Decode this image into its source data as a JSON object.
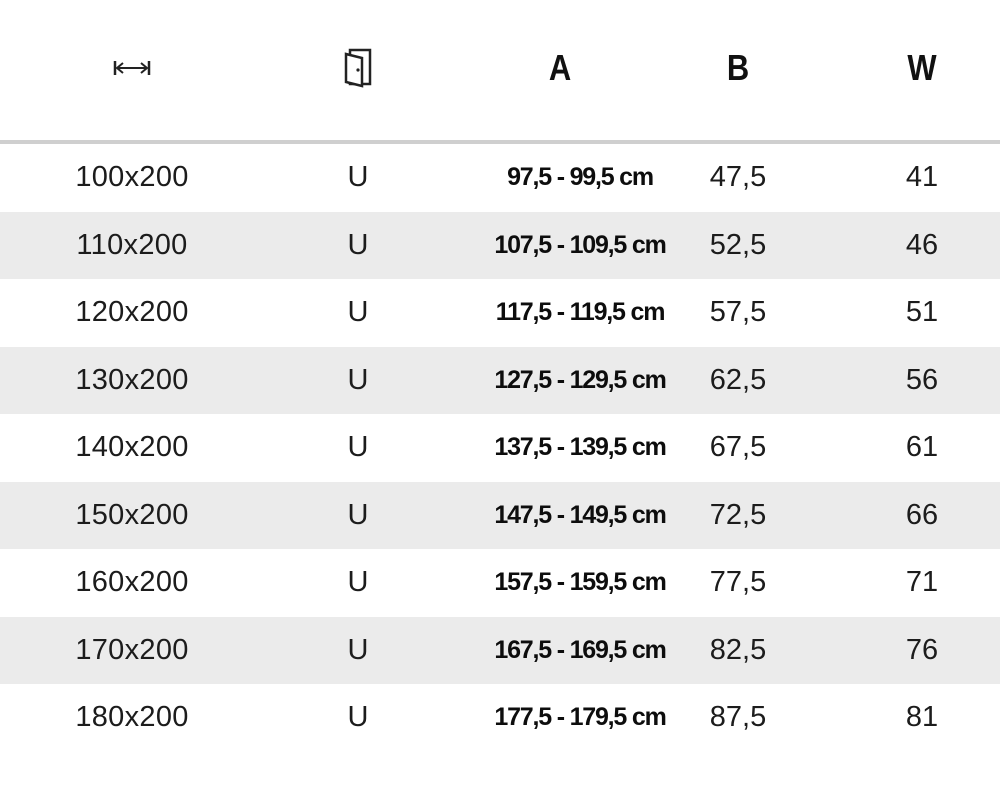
{
  "header": {
    "col_width_icon": "width-arrows-icon",
    "col_door_icon": "door-icon",
    "col_a": "A",
    "col_b": "B",
    "col_w": "W"
  },
  "rows": [
    {
      "size": "100x200",
      "type": "U",
      "a": "97,5 - 99,5 cm",
      "b": "47,5",
      "w": "41"
    },
    {
      "size": "110x200",
      "type": "U",
      "a": "107,5 - 109,5 cm",
      "b": "52,5",
      "w": "46"
    },
    {
      "size": "120x200",
      "type": "U",
      "a": "117,5 - 119,5 cm",
      "b": "57,5",
      "w": "51"
    },
    {
      "size": "130x200",
      "type": "U",
      "a": "127,5 - 129,5 cm",
      "b": "62,5",
      "w": "56"
    },
    {
      "size": "140x200",
      "type": "U",
      "a": "137,5 - 139,5 cm",
      "b": "67,5",
      "w": "61"
    },
    {
      "size": "150x200",
      "type": "U",
      "a": "147,5 - 149,5 cm",
      "b": "72,5",
      "w": "66"
    },
    {
      "size": "160x200",
      "type": "U",
      "a": "157,5 - 159,5 cm",
      "b": "77,5",
      "w": "71"
    },
    {
      "size": "170x200",
      "type": "U",
      "a": "167,5 - 169,5 cm",
      "b": "82,5",
      "w": "76"
    },
    {
      "size": "180x200",
      "type": "U",
      "a": "177,5 - 179,5 cm",
      "b": "87,5",
      "w": "81"
    }
  ],
  "colors": {
    "header_rule": "#cfcfcf",
    "alt_row_bg": "#ebebeb",
    "text": "#1a1a1a"
  }
}
